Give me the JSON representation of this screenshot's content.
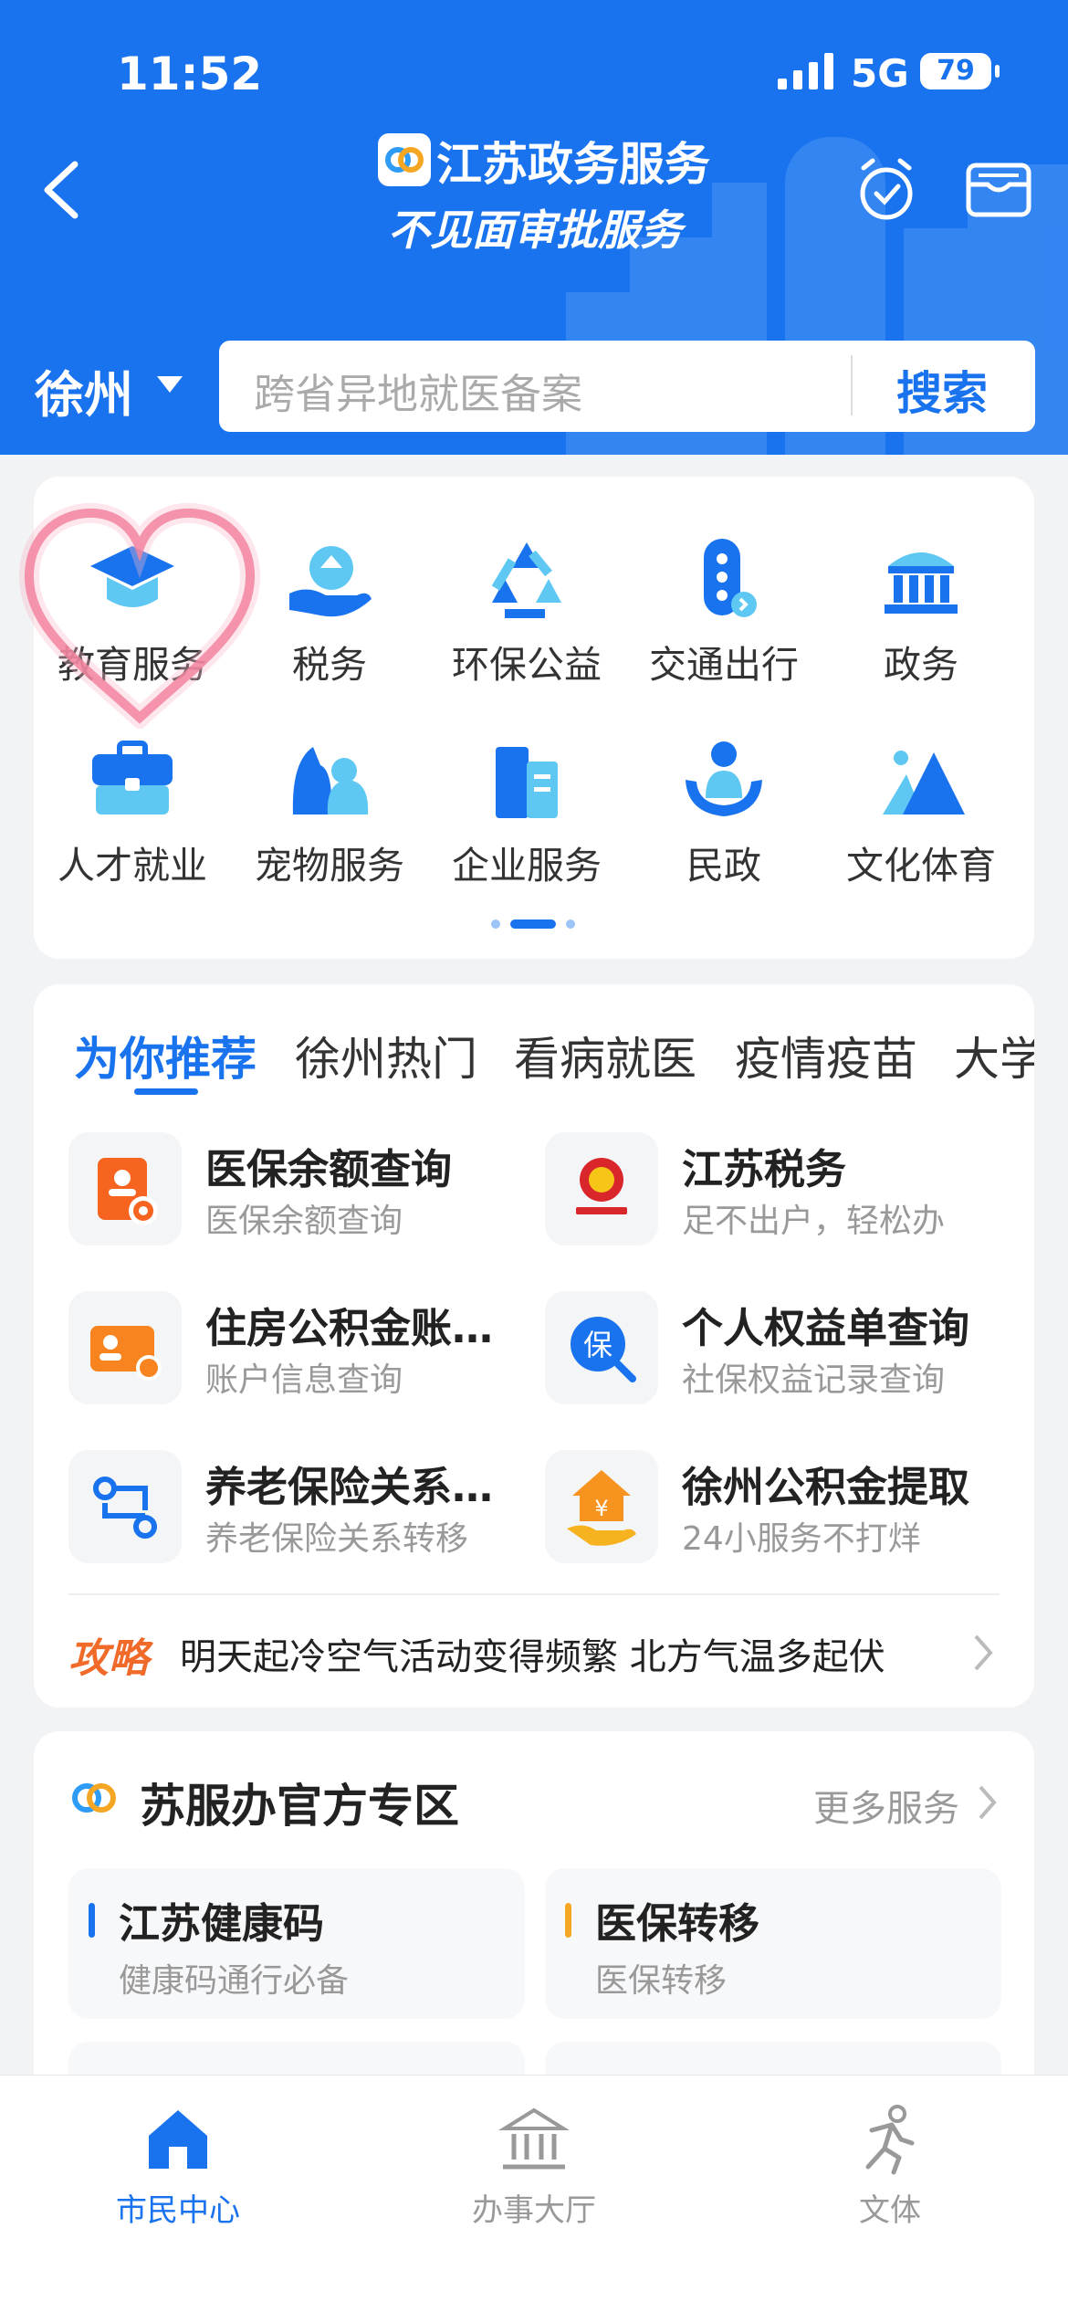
{
  "status_bar": {
    "time": "11:52",
    "network": "5G",
    "battery": "79"
  },
  "header": {
    "app_name": "江苏政务服务",
    "subtitle": "不见面审批服务",
    "city": "徐州",
    "search_placeholder": "跨省异地就医备案",
    "search_button": "搜索"
  },
  "categories": [
    {
      "label": "教育服务",
      "icon": "graduation-cap-icon"
    },
    {
      "label": "税务",
      "icon": "tax-hand-icon"
    },
    {
      "label": "环保公益",
      "icon": "recycle-icon"
    },
    {
      "label": "交通出行",
      "icon": "traffic-light-icon"
    },
    {
      "label": "政务",
      "icon": "government-building-icon"
    },
    {
      "label": "人才就业",
      "icon": "briefcase-icon"
    },
    {
      "label": "宠物服务",
      "icon": "pet-icon"
    },
    {
      "label": "企业服务",
      "icon": "enterprise-building-icon"
    },
    {
      "label": "民政",
      "icon": "people-care-icon"
    },
    {
      "label": "文化体育",
      "icon": "mountain-icon"
    }
  ],
  "recommend": {
    "tabs": [
      "为你推荐",
      "徐州热门",
      "看病就医",
      "疫情疫苗",
      "大学"
    ],
    "active_tab": 0,
    "services": [
      {
        "title": "医保余额查询",
        "subtitle": "医保余额查询",
        "icon": "medical-insurance-icon"
      },
      {
        "title": "江苏税务",
        "subtitle": "足不出户，轻松办",
        "icon": "tax-emblem-icon"
      },
      {
        "title": "住房公积金账…",
        "subtitle": "账户信息查询",
        "icon": "housing-fund-icon"
      },
      {
        "title": "个人权益单查询",
        "subtitle": "社保权益记录查询",
        "icon": "insurance-search-icon"
      },
      {
        "title": "养老保险关系…",
        "subtitle": "养老保险关系转移",
        "icon": "pension-transfer-icon"
      },
      {
        "title": "徐州公积金提取",
        "subtitle": "24小服务不打烊",
        "icon": "fund-withdraw-icon"
      }
    ],
    "tip_tag": "攻略",
    "tip_text": "明天起冷空气活动变得频繁 北方气温多起伏"
  },
  "official": {
    "title": "苏服办官方专区",
    "more": "更多服务",
    "items": [
      {
        "title": "江苏健康码",
        "subtitle": "健康码通行必备",
        "color": "#1a73ee"
      },
      {
        "title": "医保转移",
        "subtitle": "医保转移",
        "color": "#f5a623"
      }
    ]
  },
  "tabbar": {
    "items": [
      {
        "label": "市民中心",
        "icon": "home-icon",
        "active": true
      },
      {
        "label": "办事大厅",
        "icon": "hall-icon",
        "active": false
      },
      {
        "label": "文体",
        "icon": "running-icon",
        "active": false
      }
    ]
  },
  "colors": {
    "primary": "#1a73ee",
    "accent_orange": "#f5a623",
    "tip_red": "#f06a2a"
  }
}
